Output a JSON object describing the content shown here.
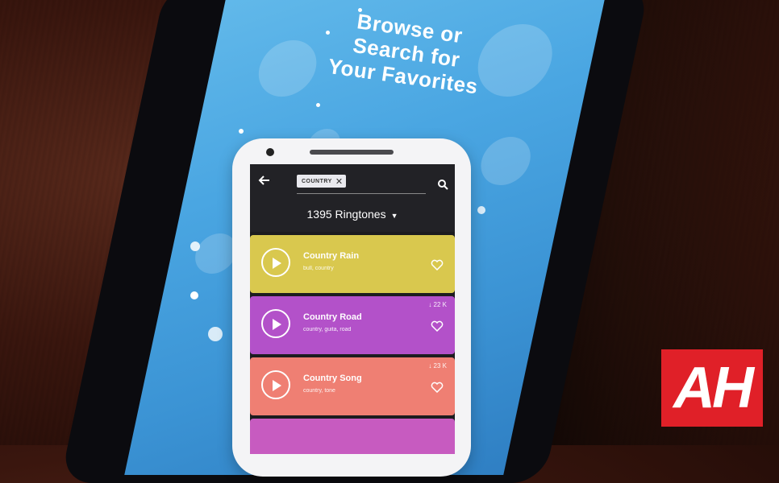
{
  "promo": {
    "headline_lines": [
      "Browse or",
      "Search for",
      "Your Favorites"
    ]
  },
  "app": {
    "search_chip": "COUNTRY",
    "result_count": "1395 Ringtones",
    "ringtones": [
      {
        "title": "Country Rain",
        "tags": "bull, country",
        "count": "",
        "color": "#d9c84e"
      },
      {
        "title": "Country Road",
        "tags": "country, guita, road",
        "count": "↓ 22 K",
        "color": "#b351c9"
      },
      {
        "title": "Country Song",
        "tags": "country, tone",
        "count": "↓ 23 K",
        "color": "#ef7f73"
      }
    ]
  },
  "logo": {
    "text": "AH",
    "color": "#e02028"
  },
  "colors": {
    "screen_blue": "#4aa6e2",
    "table_wood": "#4a2116"
  }
}
